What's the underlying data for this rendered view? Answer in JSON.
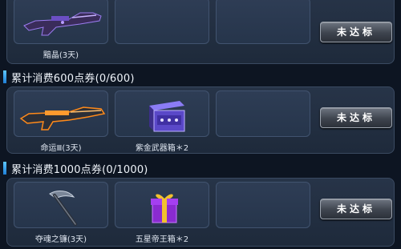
{
  "tiers": [
    {
      "title": "",
      "items": [
        {
          "label": "黯晶(3天)",
          "icon": "purple-rifle-icon"
        },
        {
          "label": "",
          "icon": ""
        },
        {
          "label": "",
          "icon": ""
        }
      ],
      "button_label": "未达标"
    },
    {
      "title": "累计消费600点券(0/600)",
      "items": [
        {
          "label": "命运Ⅲ(3天)",
          "icon": "orange-rifle-icon"
        },
        {
          "label": "紫金武器箱＊2",
          "icon": "weapon-crate-icon"
        },
        {
          "label": "",
          "icon": ""
        }
      ],
      "button_label": "未达标"
    },
    {
      "title": "累计消费1000点券(0/1000)",
      "items": [
        {
          "label": "夺魂之镰(3天)",
          "icon": "scythe-icon"
        },
        {
          "label": "五星帝王箱＊2",
          "icon": "gift-box-icon"
        },
        {
          "label": "",
          "icon": ""
        }
      ],
      "button_label": "未达标"
    }
  ],
  "colors": {
    "background": "#0d1522",
    "panel": "#273448",
    "header_accent": "#3aa6f0"
  }
}
